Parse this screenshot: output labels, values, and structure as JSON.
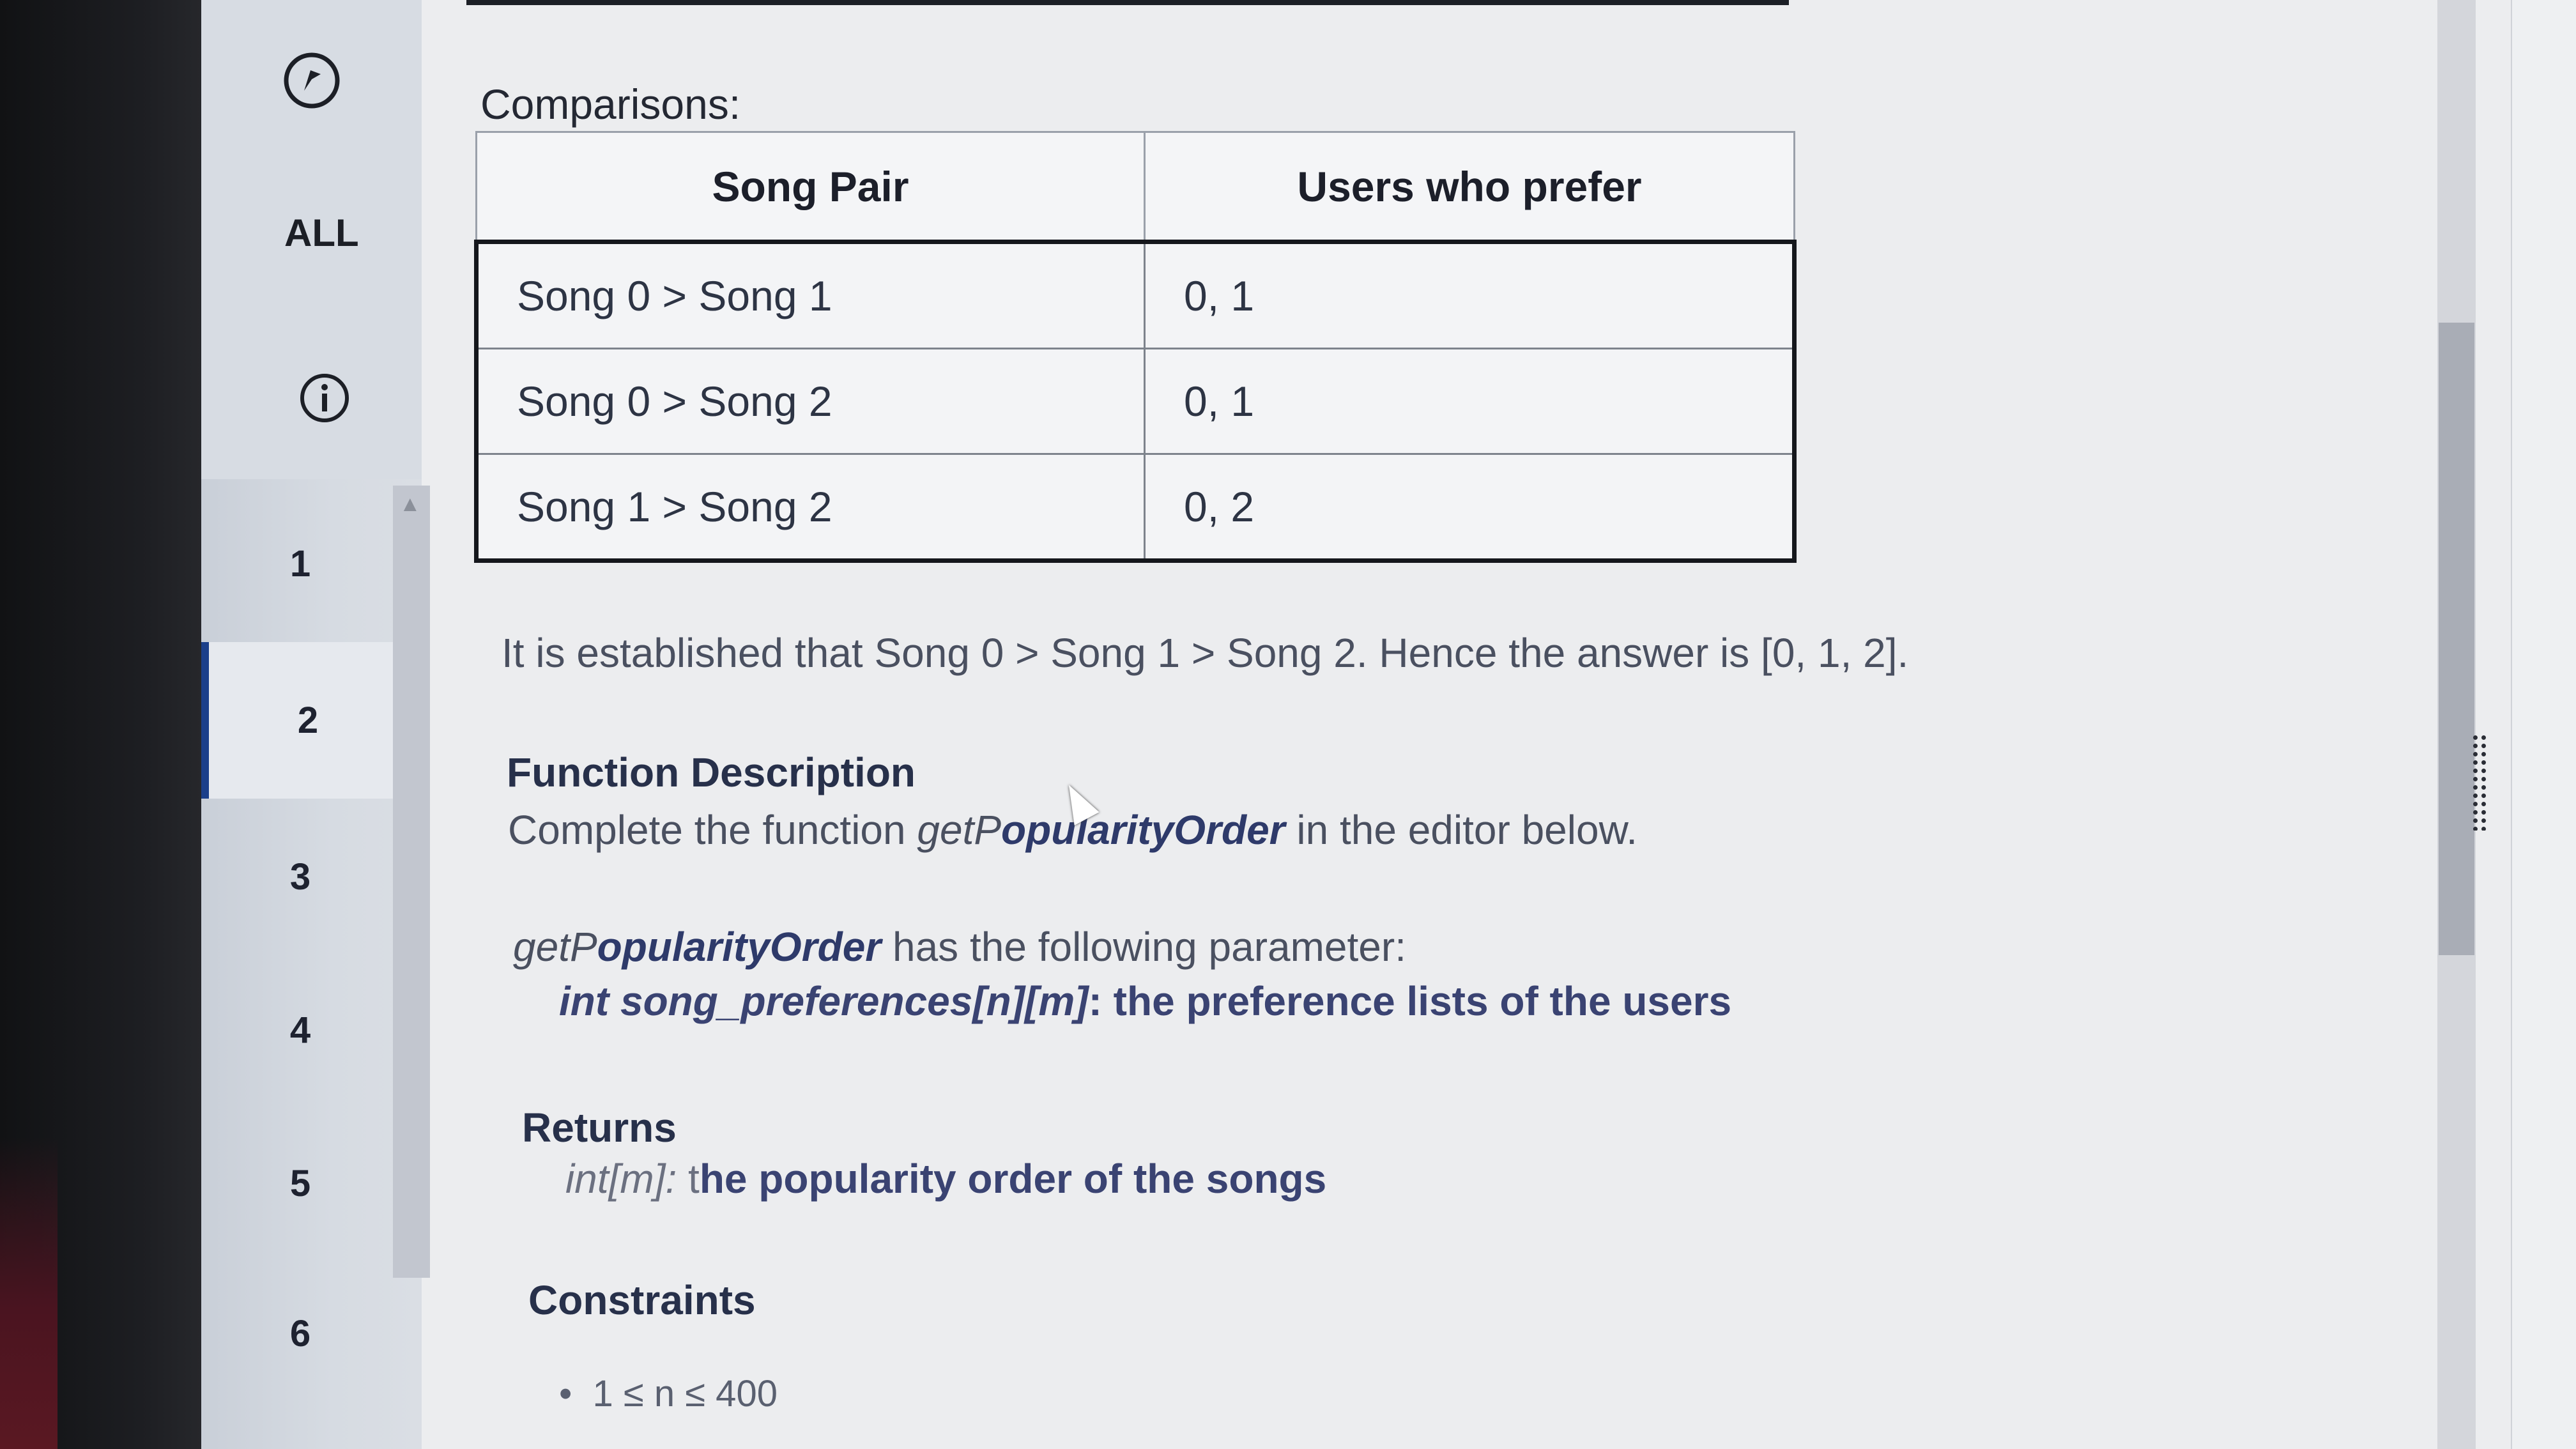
{
  "sidebar": {
    "all_label": "ALL",
    "questions": [
      "1",
      "2",
      "3",
      "4",
      "5",
      "6"
    ],
    "active_question": "2"
  },
  "content": {
    "comparisons_label": "Comparisons:",
    "table": {
      "headers": [
        "Song Pair",
        "Users who prefer"
      ],
      "rows": [
        [
          "Song 0 > Song 1",
          "0, 1"
        ],
        [
          "Song 0 > Song 2",
          "0, 1"
        ],
        [
          "Song 1 > Song 2",
          "0, 2"
        ]
      ]
    },
    "conclusion": "It is established that Song 0 > Song 1 > Song 2. Hence the answer is [0, 1, 2].",
    "function_description": {
      "heading": "Function Description",
      "text_prefix": "Complete the function ",
      "function_name_italic": "getP",
      "function_name_bold": "opularityOrder",
      "text_suffix": " in the editor below."
    },
    "parameter_line": {
      "function_name_italic": "getP",
      "function_name_bold": "opularityOrder",
      "text": " has the following parameter:"
    },
    "parameter": {
      "signature": "int song_preferences[n][m]",
      "description": ": the preference lists of the users"
    },
    "returns": {
      "heading": "Returns",
      "type": "int[m]:",
      "description_first": " t",
      "description": "he popularity order of the songs"
    },
    "constraints": {
      "heading": "Constraints",
      "items": [
        "1 ≤ n ≤ 400"
      ]
    }
  },
  "colors": {
    "accent": "#1b3f8a",
    "text": "#2d3444",
    "heading": "#27304a"
  }
}
